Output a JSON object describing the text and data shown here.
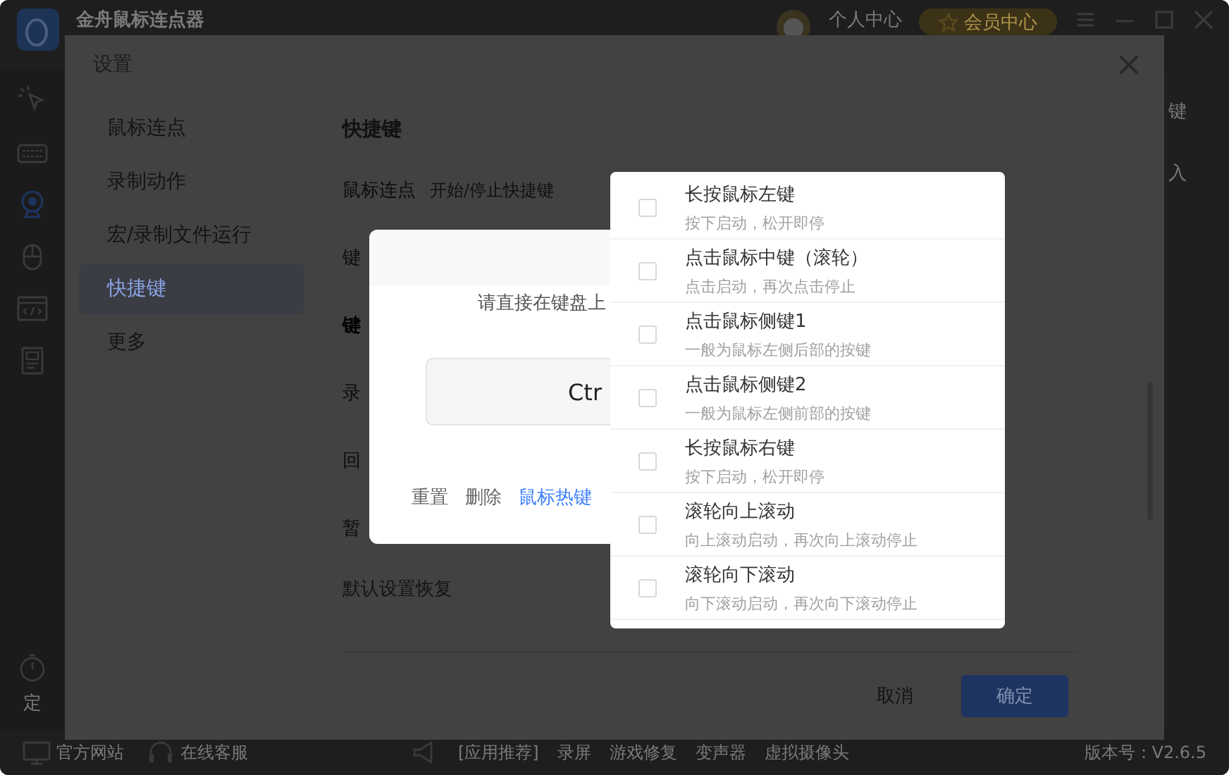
{
  "app": {
    "title": "金舟鼠标连点器",
    "user_label": "个人中心",
    "vip_label": "会员中心",
    "rail_label": "定",
    "edge_labels": [
      "键",
      "入"
    ]
  },
  "settings": {
    "title": "设置",
    "nav": [
      {
        "label": "鼠标连点",
        "selected": false
      },
      {
        "label": "录制动作",
        "selected": false
      },
      {
        "label": "宏/录制文件运行",
        "selected": false
      },
      {
        "label": "快捷键",
        "selected": true
      },
      {
        "label": "更多",
        "selected": false
      }
    ],
    "section_title": "快捷键",
    "rows": [
      {
        "label": "鼠标连点",
        "hint": "开始/停止快捷键",
        "kind": "item"
      },
      {
        "label": "键",
        "kind": "item"
      },
      {
        "label": "键",
        "kind": "subheading"
      },
      {
        "label": "录",
        "kind": "item"
      },
      {
        "label": "回",
        "kind": "item"
      },
      {
        "label": "暂",
        "kind": "item"
      }
    ],
    "restore_label": "默认设置恢复",
    "buttons": [
      {
        "label": "取消",
        "kind": "plain"
      },
      {
        "label": "确定",
        "kind": "primary"
      }
    ]
  },
  "key_dialog": {
    "prompt": "请直接在键盘上",
    "key_value": "Ctr",
    "actions": [
      {
        "label": "重置",
        "kind": "plain"
      },
      {
        "label": "删除",
        "kind": "plain"
      },
      {
        "label": "鼠标热键",
        "kind": "link"
      }
    ]
  },
  "mouse_menu": {
    "items": [
      {
        "title": "长按鼠标左键",
        "description": "按下启动，松开即停",
        "checked": false
      },
      {
        "title": "点击鼠标中键（滚轮）",
        "description": "点击启动，再次点击停止",
        "checked": false
      },
      {
        "title": "点击鼠标侧键1",
        "description": "一般为鼠标左侧后部的按键",
        "checked": false
      },
      {
        "title": "点击鼠标侧键2",
        "description": "一般为鼠标左侧前部的按键",
        "checked": false
      },
      {
        "title": "长按鼠标右键",
        "description": "按下启动，松开即停",
        "checked": false
      },
      {
        "title": "滚轮向上滚动",
        "description": "向上滚动启动，再次向上滚动停止",
        "checked": false
      },
      {
        "title": "滚轮向下滚动",
        "description": "向下滚动启动，再次向下滚动停止",
        "checked": false
      }
    ]
  },
  "footer": {
    "links": [
      "官方网站",
      "在线客服"
    ],
    "promo_label": "[应用推荐]",
    "promo_items": [
      "录屏",
      "游戏修复",
      "变声器",
      "虚拟摄像头"
    ],
    "version": "版本号：V2.6.5"
  }
}
